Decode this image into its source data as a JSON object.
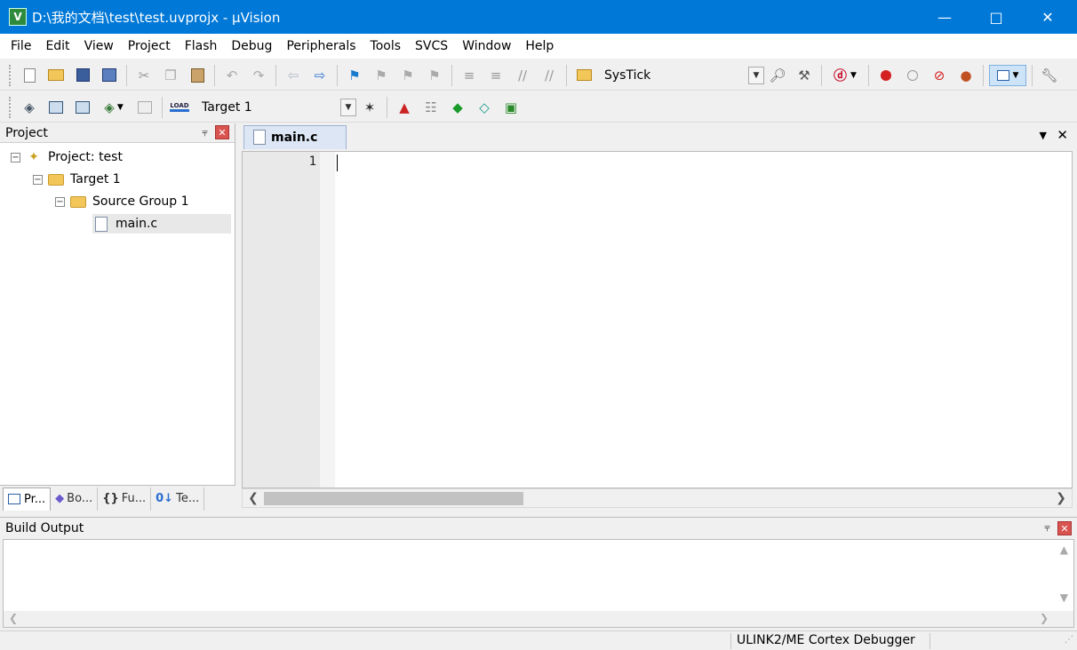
{
  "window": {
    "title": "D:\\我的文档\\test\\test.uvprojx - µVision",
    "app_icon": "keil-v-icon",
    "controls": [
      "minimize",
      "maximize",
      "close"
    ]
  },
  "menu": [
    {
      "label": "File"
    },
    {
      "label": "Edit"
    },
    {
      "label": "View"
    },
    {
      "label": "Project"
    },
    {
      "label": "Flash"
    },
    {
      "label": "Debug"
    },
    {
      "label": "Peripherals"
    },
    {
      "label": "Tools"
    },
    {
      "label": "SVCS"
    },
    {
      "label": "Window"
    },
    {
      "label": "Help"
    }
  ],
  "toolbar1": {
    "find_combo_value": "SysTick"
  },
  "toolbar2": {
    "target_combo_value": "Target 1",
    "load_label": "LOAD"
  },
  "project_panel": {
    "title": "Project",
    "tree": {
      "root": "Project: test",
      "target": "Target 1",
      "group": "Source Group 1",
      "file": "main.c"
    },
    "tabs": [
      "Pr...",
      "Bo...",
      "Fu...",
      "Te..."
    ],
    "tab_glyphs": [
      "{}",
      "0↓"
    ]
  },
  "editor": {
    "active_tab": "main.c",
    "line_numbers": [
      "1"
    ],
    "content": ""
  },
  "build_output": {
    "title": "Build Output"
  },
  "status_bar": {
    "debugger": "ULINK2/ME Cortex Debugger"
  },
  "colors": {
    "titlebar": "#0078d7",
    "close_badge": "#d9534f",
    "tab_active": "#dce6f4"
  }
}
